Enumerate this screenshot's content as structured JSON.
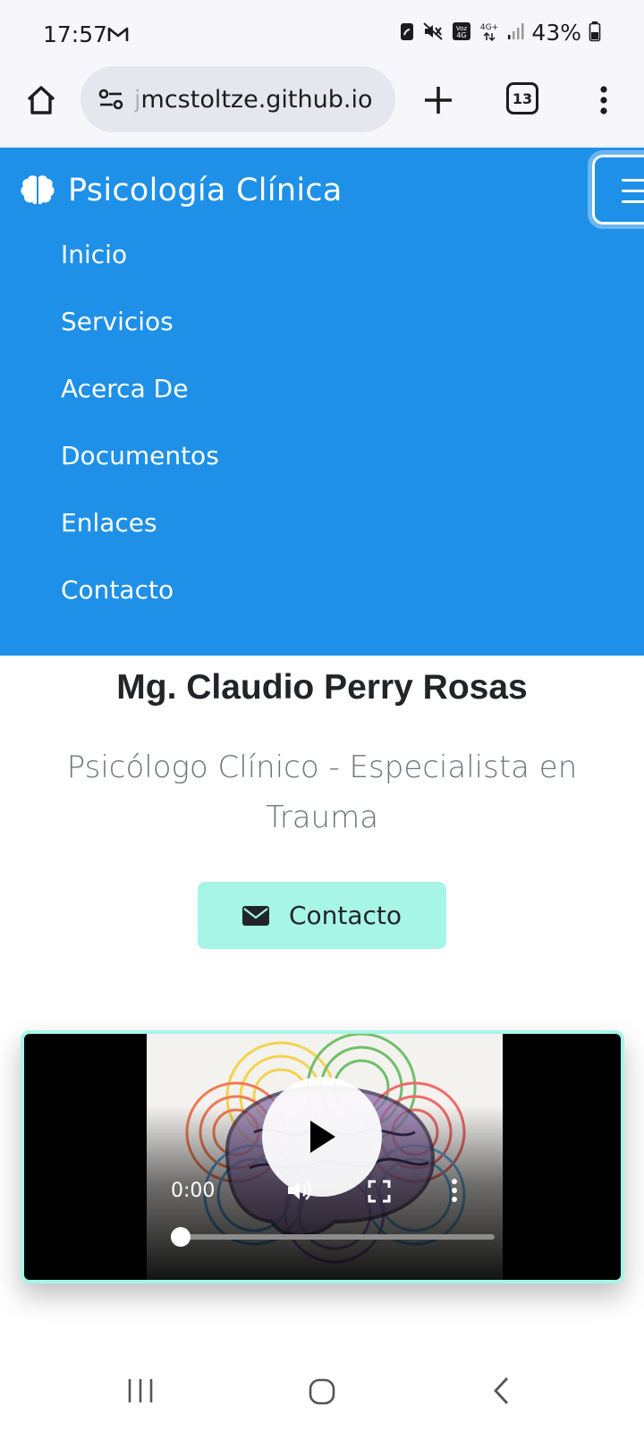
{
  "status_bar": {
    "time": "17:57",
    "battery": "43%",
    "icons": [
      "gmail-icon",
      "battery-saver-icon",
      "mute-icon",
      "volte-icon",
      "4g-plus-icon",
      "signal-icon",
      "battery-icon"
    ]
  },
  "browser": {
    "url": "mcstoltze.github.io",
    "url_prefix": "j",
    "tab_count": "13",
    "icons": [
      "home-icon",
      "site-settings-icon",
      "new-tab-icon",
      "tabs-icon",
      "more-vert-icon"
    ]
  },
  "navbar": {
    "brand": "Psicología Clínica",
    "brand_icon": "brain-icon",
    "items": [
      {
        "label": "Inicio"
      },
      {
        "label": "Servicios"
      },
      {
        "label": "Acerca De"
      },
      {
        "label": "Documentos"
      },
      {
        "label": "Enlaces"
      },
      {
        "label": "Contacto"
      }
    ]
  },
  "hero": {
    "name": "Mg. Claudio Perry Rosas",
    "subtitle": "Psicólogo Clínico - Especialista en Trauma",
    "contact_button": "Contacto",
    "contact_icon": "envelope-icon"
  },
  "video": {
    "current_time": "0:00",
    "progress": 0,
    "icons": [
      "play-icon",
      "volume-icon",
      "fullscreen-icon",
      "more-vert-icon"
    ]
  },
  "colors": {
    "navbar_bg": "#1e90e8",
    "accent": "#a7f5e6",
    "heading": "#212529",
    "muted": "#6c757d"
  }
}
